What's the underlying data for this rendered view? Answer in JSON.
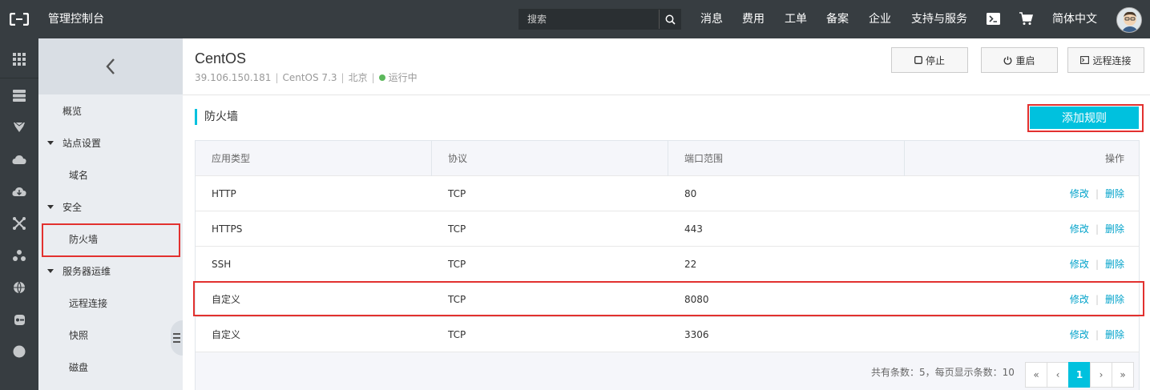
{
  "topbar": {
    "brand": "管理控制台",
    "search_placeholder": "搜索",
    "nav": [
      "消息",
      "费用",
      "工单",
      "备案",
      "企业",
      "支持与服务"
    ],
    "language": "简体中文"
  },
  "rail": {
    "icons": [
      "grid-icon",
      "server-icon",
      "shield-icon",
      "cloud-upload-icon",
      "cloud-download-icon",
      "network-icon",
      "cluster-icon",
      "globe-icon",
      "pipeline-icon",
      "circle-icon"
    ]
  },
  "sidebar": {
    "items": [
      {
        "label": "概览",
        "level": 1
      },
      {
        "label": "站点设置",
        "level": "group"
      },
      {
        "label": "域名",
        "level": 2
      },
      {
        "label": "安全",
        "level": "group"
      },
      {
        "label": "防火墙",
        "level": 2,
        "active": true
      },
      {
        "label": "服务器运维",
        "level": "group"
      },
      {
        "label": "远程连接",
        "level": 2
      },
      {
        "label": "快照",
        "level": 2
      },
      {
        "label": "磁盘",
        "level": 2
      }
    ]
  },
  "instance": {
    "name": "CentOS",
    "ip": "39.106.150.181",
    "os": "CentOS 7.3",
    "region": "北京",
    "status": "运行中",
    "status_color": "#5cb85c"
  },
  "actions": {
    "stop": "停止",
    "restart": "重启",
    "remote": "远程连接"
  },
  "firewall": {
    "title": "防火墙",
    "add_rule": "添加规则",
    "columns": [
      "应用类型",
      "协议",
      "端口范围",
      "操作"
    ],
    "rows": [
      {
        "type": "HTTP",
        "protocol": "TCP",
        "port": "80",
        "edit": "修改",
        "delete": "删除"
      },
      {
        "type": "HTTPS",
        "protocol": "TCP",
        "port": "443",
        "edit": "修改",
        "delete": "删除"
      },
      {
        "type": "SSH",
        "protocol": "TCP",
        "port": "22",
        "edit": "修改",
        "delete": "删除"
      },
      {
        "type": "自定义",
        "protocol": "TCP",
        "port": "8080",
        "edit": "修改",
        "delete": "删除"
      },
      {
        "type": "自定义",
        "protocol": "TCP",
        "port": "3306",
        "edit": "修改",
        "delete": "删除"
      }
    ],
    "pagination": {
      "info": "共有条数：5，每页显示条数：10",
      "first": "«",
      "prev": "‹",
      "current": "1",
      "next": "›",
      "last": "»"
    }
  },
  "colors": {
    "topbar": "#373d41",
    "accent": "#00c1de",
    "link": "#00a2ca",
    "highlight": "#e2312f"
  }
}
